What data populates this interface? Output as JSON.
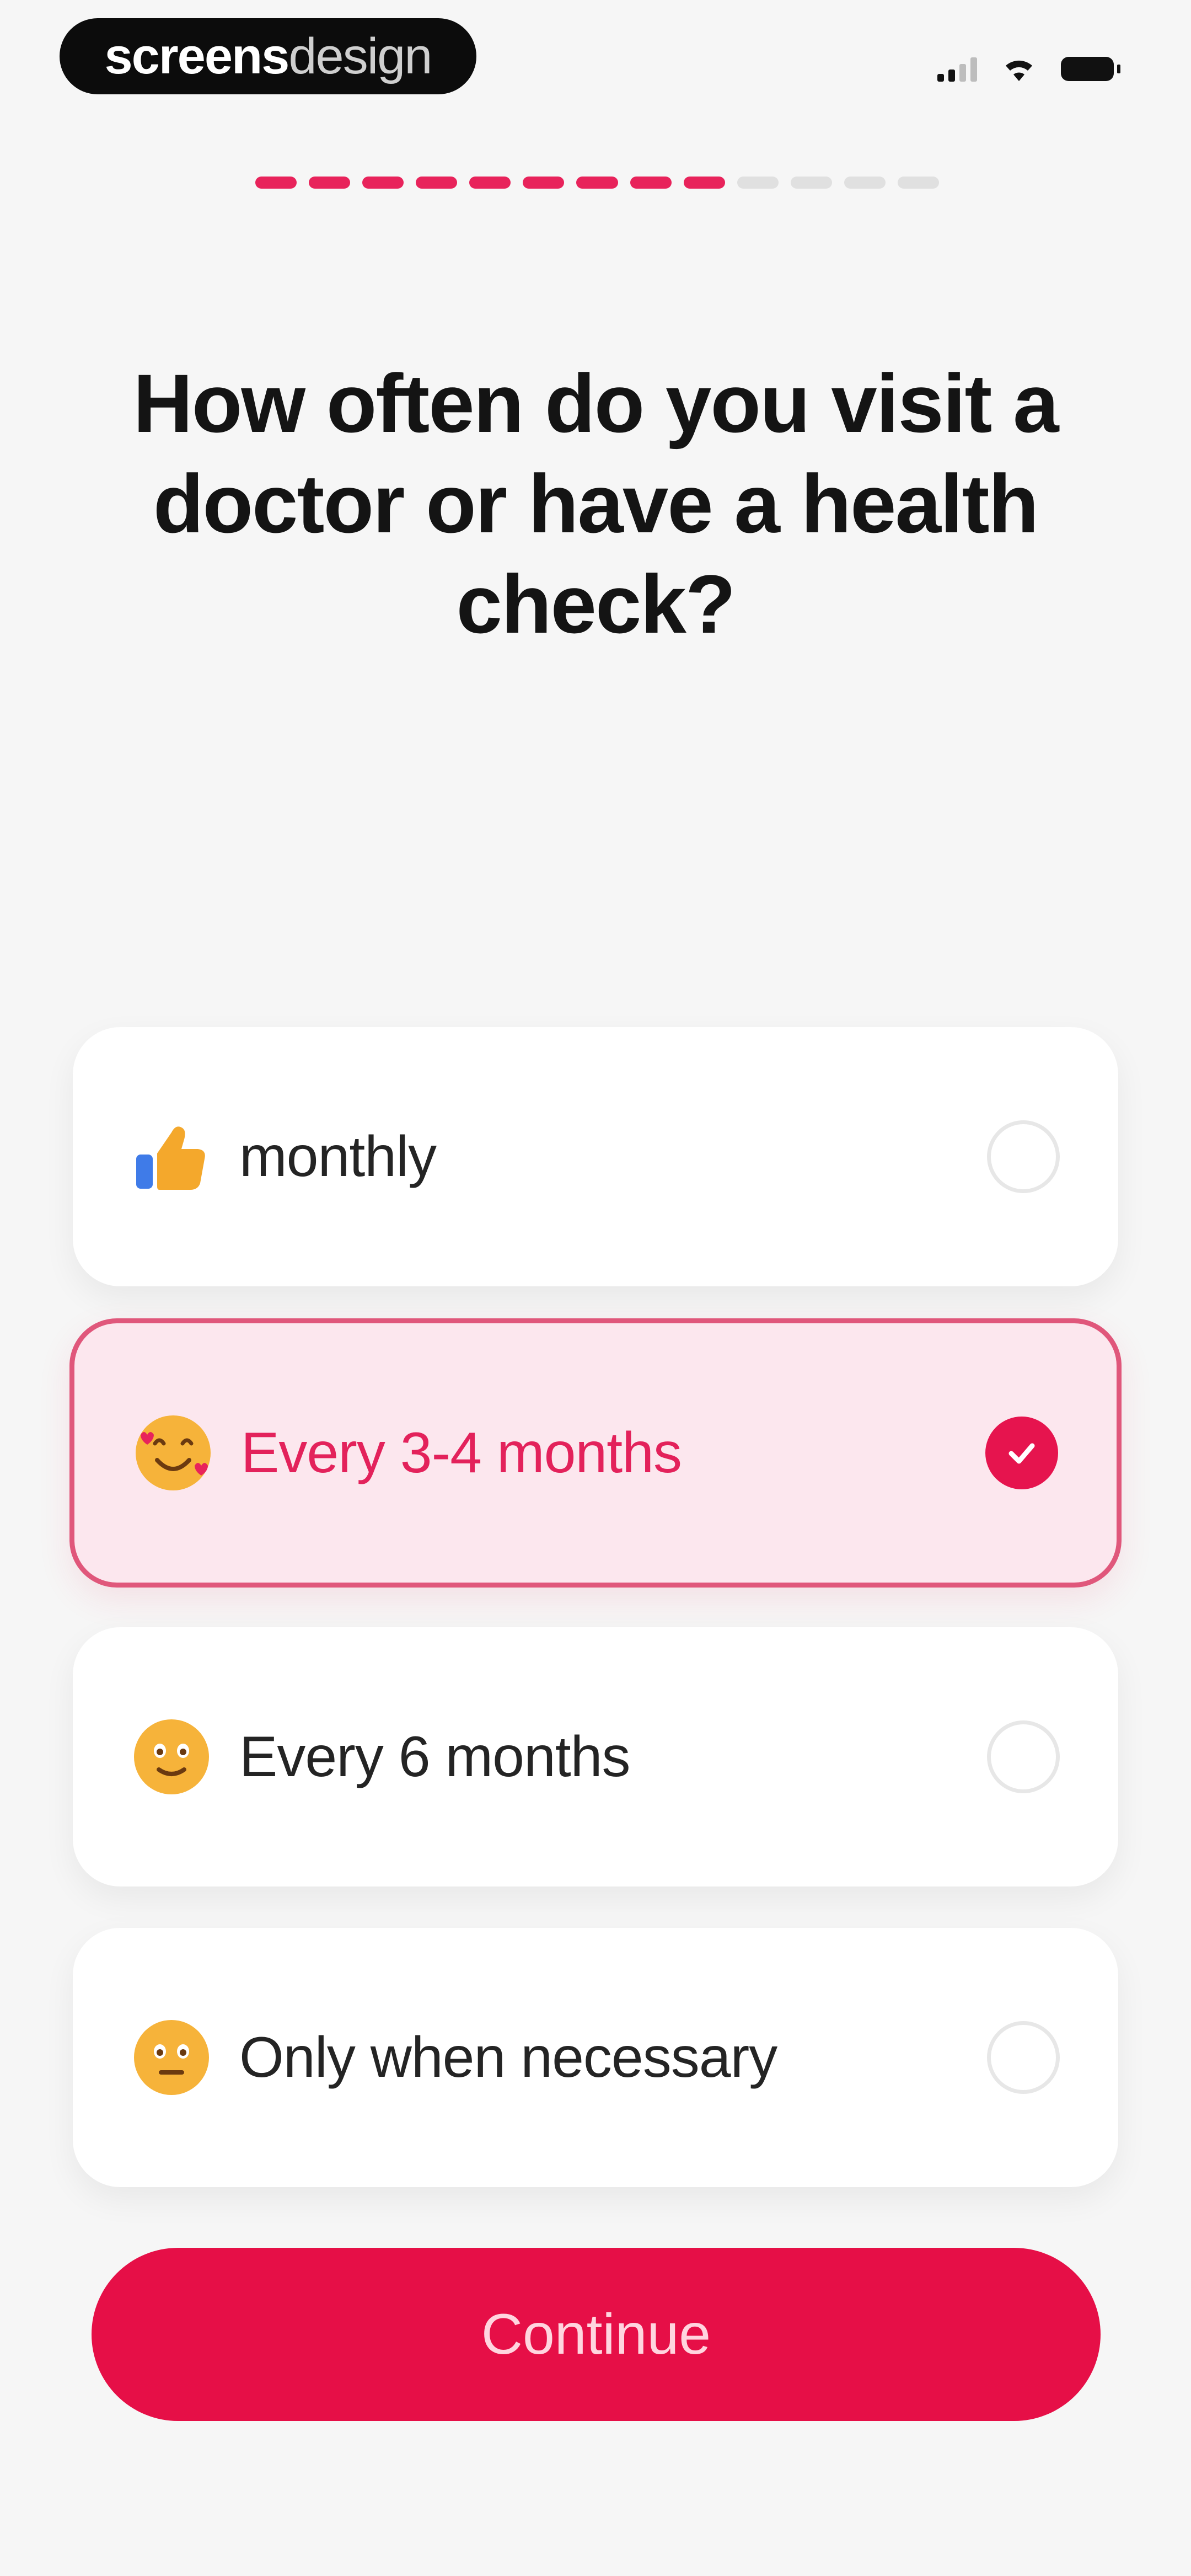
{
  "status_bar": {
    "brand_bold": "screens",
    "brand_light": "design"
  },
  "progress": {
    "completed_steps": 9,
    "total_steps": 13
  },
  "question": {
    "title": "How often do you visit a doctor or have a health check?"
  },
  "options": [
    {
      "label": "monthly",
      "icon": "thumbs-up-icon",
      "selected": false
    },
    {
      "label": "Every 3-4 months",
      "icon": "smiling-face-with-hearts-icon",
      "selected": true
    },
    {
      "label": "Every 6 months",
      "icon": "slightly-smiling-face-icon",
      "selected": false
    },
    {
      "label": "Only when necessary",
      "icon": "neutral-face-icon",
      "selected": false
    }
  ],
  "continue_label": "Continue",
  "colors": {
    "accent": "#e60f47",
    "selected_bg": "#fce7ee",
    "selected_border": "#e0577b",
    "background": "#f6f6f6"
  }
}
